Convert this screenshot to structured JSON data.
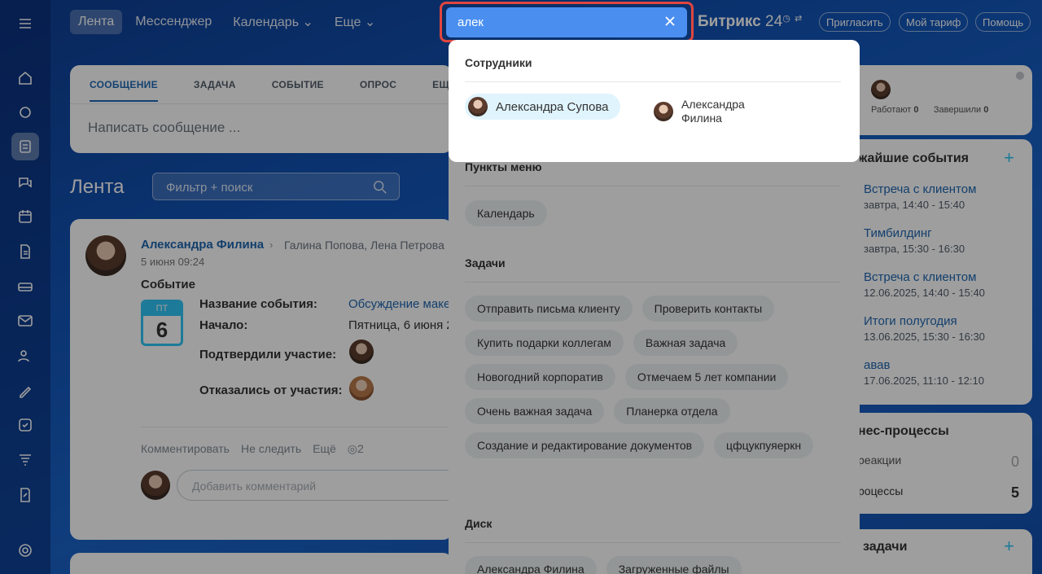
{
  "topnav": {
    "tabs": [
      "Лента",
      "Мессенджер",
      "Календарь ⌄",
      "Еще ⌄"
    ],
    "brand": "Битрикс",
    "brand_num": "24",
    "invite": "Пригласить",
    "tariff": "Мой тариф",
    "help": "Помощь"
  },
  "search": {
    "value": "алек"
  },
  "composer": {
    "tabs": [
      "СООБЩЕНИЕ",
      "ЗАДАЧА",
      "СОБЫТИЕ",
      "ОПРОС",
      "ЕЩ"
    ],
    "placeholder": "Написать сообщение ..."
  },
  "feed": {
    "title": "Лента",
    "filter_placeholder": "Фильтр + поиск"
  },
  "post": {
    "author": "Александра Филина",
    "recipients": "Галина Попова, Лена Петрова",
    "date": "5 июня 09:24",
    "kind": "Событие",
    "calendar": {
      "dow": "ПТ",
      "day": "6"
    },
    "fields": {
      "name_label": "Название события:",
      "name_value": "Обсуждение маке",
      "start_label": "Начало:",
      "start_value": "Пятница, 6 июня 2",
      "confirmed_label": "Подтвердили участие:",
      "declined_label": "Отказались от участия:"
    },
    "actions": [
      "Комментировать",
      "Не следить",
      "Ещё",
      "◎2"
    ],
    "comment_placeholder": "Добавить комментарий"
  },
  "right": {
    "stats": {
      "working": "Работают",
      "working_count": "0",
      "done": "Завершили",
      "done_count": "0"
    },
    "events_title": "жайшие события",
    "events": [
      {
        "title": "Встреча с клиентом",
        "when": "завтра, 14:40 - 15:40"
      },
      {
        "title": "Тимбилдинг",
        "when": "завтра, 15:30 - 16:30"
      },
      {
        "title": "Встреча с клиентом",
        "when": "12.06.2025, 14:40 - 15:40"
      },
      {
        "title": "Итоги полугодия",
        "when": "13.06.2025, 15:30 - 16:30"
      },
      {
        "title": "авав",
        "when": "17.06.2025, 11:10 - 12:10"
      }
    ],
    "bp_title": "нес-процессы",
    "bp_rows": [
      {
        "label": "реакции",
        "value": "0"
      },
      {
        "label": "роцессы",
        "value": "5"
      }
    ],
    "tasks_title": "задачи"
  },
  "results": {
    "employees_title": "Сотрудники",
    "employees": [
      "Александра Супова",
      "Александра Филина"
    ],
    "menu_title": "Пункты меню",
    "menu": [
      "Календарь"
    ],
    "tasks_title": "Задачи",
    "tasks": [
      "Отправить письма клиенту",
      "Проверить контакты",
      "Купить подарки коллегам",
      "Важная задача",
      "Новогодний корпоратив",
      "Отмечаем 5 лет компании",
      "Очень важная задача",
      "Планерка отдела",
      "Создание и редактирование документов",
      "цфцукпуяеркн"
    ],
    "disk_title": "Диск",
    "disk": [
      "Александра Филина",
      "Загруженные файлы"
    ]
  }
}
